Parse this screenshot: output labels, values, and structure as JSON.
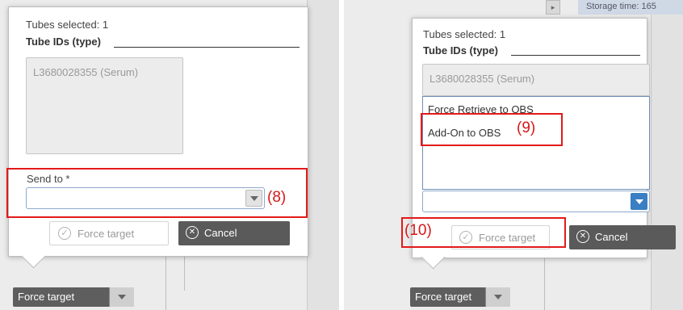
{
  "left": {
    "tubes_selected": "Tubes selected: 1",
    "tube_ids_label": "Tube IDs (type)",
    "tube_entry": "L3680028355 (Serum)",
    "send_to_label": "Send to *",
    "force_target_button": "Force target",
    "cancel_button": "Cancel",
    "bottom_button": "Force target",
    "callout": "(8)"
  },
  "right": {
    "background_text": "Storage time: 165",
    "tubes_selected": "Tubes selected: 1",
    "tube_ids_label": "Tube IDs (type)",
    "tube_entry": "L3680028355 (Serum)",
    "dropdown_options": [
      "Force Retrieve to OBS",
      "Add-On to OBS"
    ],
    "force_target_button": "Force target",
    "cancel_button": "Cancel",
    "bottom_button": "Force target",
    "callout_option": "(9)",
    "callout_button": "(10)"
  },
  "colors": {
    "callout": "#e31a1a",
    "select_caret_active": "#3a7fc3",
    "cancel_bg": "#5a5a5a"
  },
  "icons": [
    "check-circle-icon",
    "x-circle-icon",
    "chevron-down-icon"
  ]
}
